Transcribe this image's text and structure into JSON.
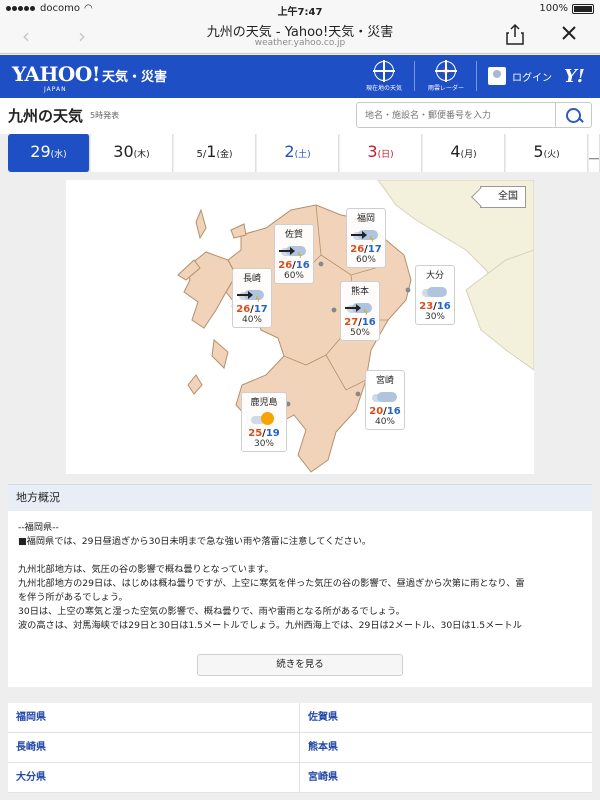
{
  "status_bar": {
    "carrier": "docomo",
    "time": "上午7:47",
    "battery": "100%"
  },
  "browser": {
    "title": "九州の天気 - Yahoo!天気・災害",
    "url": "weather.yahoo.co.jp"
  },
  "header": {
    "logo": "YAHOO!",
    "logo_sub": "JAPAN",
    "service": "天気・災害",
    "current_location_label": "現在地の天気",
    "radar_label": "雨雲レーダー",
    "login_label": "ログイン"
  },
  "title_row": {
    "title": "九州の天気",
    "issued": "5時発表",
    "search_placeholder": "地名・施設名・郵便番号を入力"
  },
  "days": [
    {
      "num": "29",
      "wd": "(水)",
      "type": "sel"
    },
    {
      "num": "30",
      "wd": "(木)",
      "type": "normal"
    },
    {
      "prefix": "5/",
      "num": "1",
      "wd": "(金)",
      "type": "normal"
    },
    {
      "num": "2",
      "wd": "(土)",
      "type": "sat"
    },
    {
      "num": "3",
      "wd": "(日)",
      "type": "sun"
    },
    {
      "num": "4",
      "wd": "(月)",
      "type": "normal"
    },
    {
      "num": "5",
      "wd": "(火)",
      "type": "normal"
    },
    {
      "num": "＿",
      "wd": "",
      "type": "normal"
    }
  ],
  "map": {
    "all_label": "全国",
    "cities": [
      {
        "name": "福岡",
        "hi": "26",
        "lo": "17",
        "pop": "60%",
        "weather": "thunder-cloud"
      },
      {
        "name": "佐賀",
        "hi": "26",
        "lo": "16",
        "pop": "60%",
        "weather": "thunder-cloud"
      },
      {
        "name": "長崎",
        "hi": "26",
        "lo": "17",
        "pop": "40%",
        "weather": "thunder-cloud"
      },
      {
        "name": "熊本",
        "hi": "27",
        "lo": "16",
        "pop": "50%",
        "weather": "thunder-cloud"
      },
      {
        "name": "大分",
        "hi": "23",
        "lo": "16",
        "pop": "30%",
        "weather": "cloud"
      },
      {
        "name": "宮崎",
        "hi": "20",
        "lo": "16",
        "pop": "40%",
        "weather": "cloud"
      },
      {
        "name": "鹿児島",
        "hi": "25",
        "lo": "19",
        "pop": "30%",
        "weather": "cloud-sun"
      }
    ]
  },
  "overview": {
    "heading": "地方概況",
    "lines": [
      "--福岡県--",
      "■福岡県では、29日昼過ぎから30日未明まで急な強い雨や落雷に注意してください。",
      "",
      "九州北部地方は、気圧の谷の影響で概ね曇りとなっています。",
      "九州北部地方の29日は、はじめは概ね曇りですが、上空に寒気を伴った気圧の谷の影響で、昼過ぎから次第に雨となり、雷",
      "を伴う所があるでしょう。",
      "30日は、上空の寒気と湿った空気の影響で、概ね曇りで、雨や雷雨となる所があるでしょう。",
      "波の高さは、対馬海峡では29日と30日は1.5メートルでしょう。九州西海上では、29日は2メートル、30日は1.5メートル"
    ],
    "more_label": "続きを見る"
  },
  "prefectures": [
    [
      "福岡県",
      "佐賀県"
    ],
    [
      "長崎県",
      "熊本県"
    ],
    [
      "大分県",
      "宮崎県"
    ]
  ],
  "colors": {
    "brand": "#1f4fc4",
    "high_temp": "#d84d1c",
    "low_temp": "#2563c4",
    "sunday": "#c8182b",
    "land": "#f0d3b8"
  }
}
